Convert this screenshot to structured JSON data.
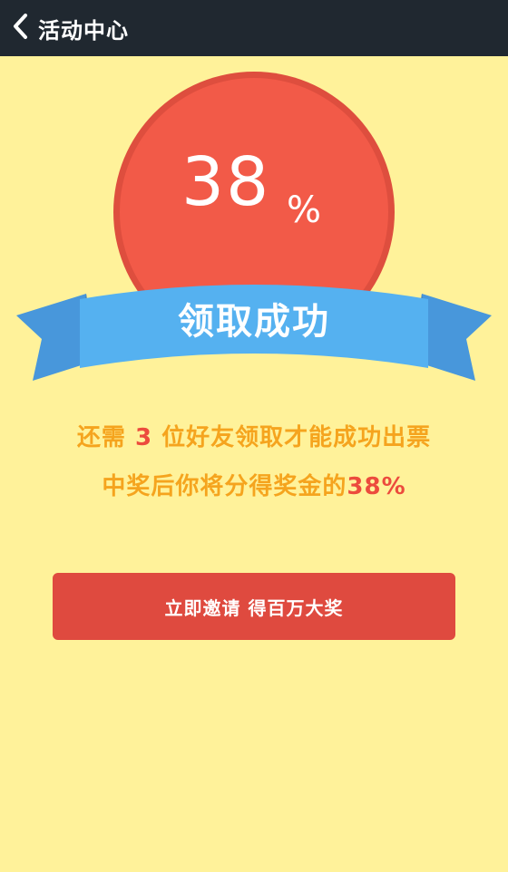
{
  "header": {
    "title": "活动中心",
    "back_icon": "chevron-left-icon"
  },
  "badge": {
    "percent_number": "38",
    "percent_sign": "%",
    "ribbon_text": "领取成功",
    "circle_color": "#F25A48",
    "ribbon_color": "#55B1F0"
  },
  "message": {
    "line1_prefix": "还需 ",
    "line1_count": "3",
    "line1_suffix": " 位好友领取才能成功出票",
    "line2_prefix": "中奖后你将分得奖金的",
    "line2_percent": "38%"
  },
  "cta": {
    "label": "立即邀请 得百万大奖",
    "color": "#DF4A3F"
  },
  "colors": {
    "background": "#FFF29A",
    "header_background": "#202830",
    "message_text": "#F5A41E",
    "highlight": "#EC4B3D"
  }
}
